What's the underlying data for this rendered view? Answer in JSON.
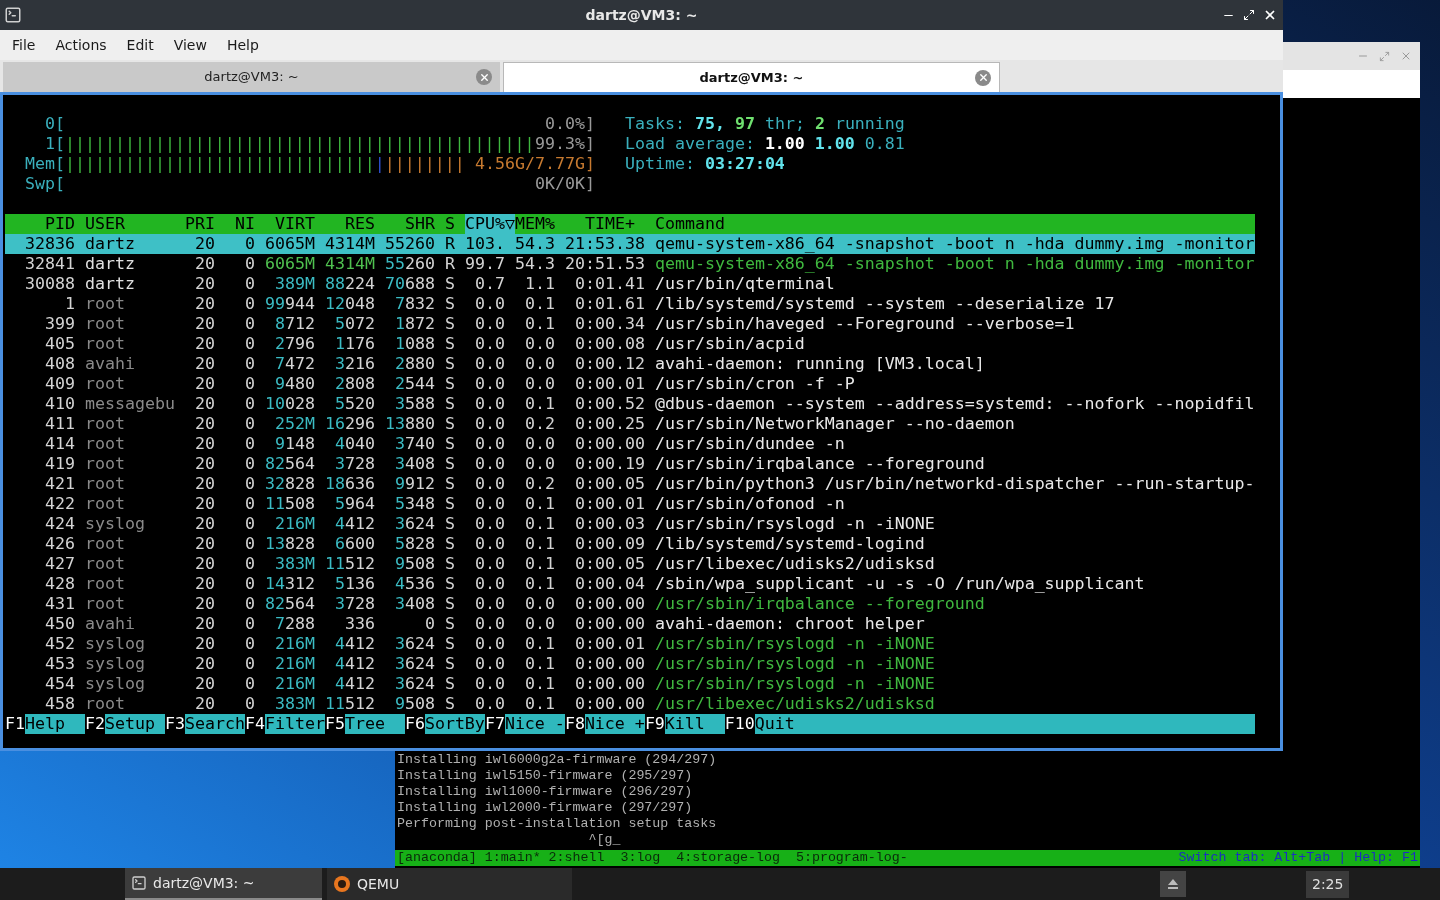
{
  "terminal_window": {
    "title": "dartz@VM3: ~",
    "menu": [
      "File",
      "Actions",
      "Edit",
      "View",
      "Help"
    ],
    "tabs": [
      {
        "label": "dartz@VM3: ~",
        "selected": false
      },
      {
        "label": "dartz@VM3: ~",
        "selected": true
      }
    ],
    "htop": {
      "cpu_meters": [
        {
          "label": "0[",
          "reading": "0.0%]"
        },
        {
          "label": "1[",
          "bar_parts": [
            {
              "text": "|||||||||||||||||||||||||||||||||||||||||||||||",
              "color": "#3fb83f"
            }
          ],
          "reading": "99.3%]"
        }
      ],
      "memory_meter": {
        "label": "Mem[",
        "reading": "4.56G/7.77G]",
        "bar_parts": [
          {
            "text": "|||||||||||||||||||||||||||||||",
            "color": "#3fb83f"
          },
          {
            "text": "|",
            "color": "#2f50d0"
          },
          {
            "text": "||||||||",
            "color": "#c77a30"
          }
        ]
      },
      "swap_meter": {
        "label": "Swp[",
        "reading": "0K/0K]"
      },
      "summary": [
        [
          {
            "text": "Tasks:",
            "kind": "label"
          },
          {
            "text": "75,",
            "kind": "cyan"
          },
          {
            "text": "97",
            "kind": "green"
          },
          {
            "text": "thr;",
            "kind": "label"
          },
          {
            "text": "2",
            "kind": "green"
          },
          {
            "text": "running",
            "kind": "label"
          }
        ],
        [
          {
            "text": "Load average:",
            "kind": "label"
          },
          {
            "text": "1.00",
            "kind": "white"
          },
          {
            "text": "1.00",
            "kind": "cyan"
          },
          {
            "text": "0.81",
            "kind": "label"
          }
        ],
        [
          {
            "text": "Uptime:",
            "kind": "label"
          },
          {
            "text": "03:27:04",
            "kind": "cyan"
          }
        ]
      ],
      "columns": [
        {
          "label": "PID",
          "sorted": false
        },
        {
          "label": "USER",
          "sorted": false
        },
        {
          "label": "PRI",
          "sorted": false
        },
        {
          "label": "NI",
          "sorted": false
        },
        {
          "label": "VIRT",
          "sorted": false
        },
        {
          "label": "RES",
          "sorted": false
        },
        {
          "label": "SHR",
          "sorted": false
        },
        {
          "label": "S",
          "sorted": false
        },
        {
          "label": "CPU%▽",
          "sorted": true
        },
        {
          "label": "MEM%",
          "sorted": false
        },
        {
          "label": "TIME+",
          "sorted": false
        },
        {
          "label": "Command",
          "sorted": false
        }
      ],
      "rows": [
        {
          "pid": "32836",
          "user": "dartz",
          "pri": "20",
          "ni": "0",
          "virt": "6065M",
          "res": "4314M",
          "shr": "55260",
          "state": "R",
          "cpu": "103.",
          "mem": "54.3",
          "time": "21:53.38",
          "command": "qemu-system-x86_64 -snapshot -boot n -hda dummy.img -monitor",
          "selected": true,
          "thread": false
        },
        {
          "pid": "32841",
          "user": "dartz",
          "pri": "20",
          "ni": "0",
          "virt": "6065M",
          "res": "4314M",
          "shr": "55260",
          "state": "R",
          "cpu": "99.7",
          "mem": "54.3",
          "time": "20:51.53",
          "command": "qemu-system-x86_64 -snapshot -boot n -hda dummy.img -monitor",
          "selected": false,
          "thread": true
        },
        {
          "pid": "30088",
          "user": "dartz",
          "pri": "20",
          "ni": "0",
          "virt": "389M",
          "res": "88224",
          "shr": "70688",
          "state": "S",
          "cpu": "0.7",
          "mem": "1.1",
          "time": "0:01.41",
          "command": "/usr/bin/qterminal",
          "selected": false,
          "thread": false
        },
        {
          "pid": "1",
          "user": "root",
          "pri": "20",
          "ni": "0",
          "virt": "99944",
          "res": "12048",
          "shr": "7832",
          "state": "S",
          "cpu": "0.0",
          "mem": "0.1",
          "time": "0:01.61",
          "command": "/lib/systemd/systemd --system --deserialize 17",
          "selected": false,
          "thread": false
        },
        {
          "pid": "399",
          "user": "root",
          "pri": "20",
          "ni": "0",
          "virt": "8712",
          "res": "5072",
          "shr": "1872",
          "state": "S",
          "cpu": "0.0",
          "mem": "0.1",
          "time": "0:00.34",
          "command": "/usr/sbin/haveged --Foreground --verbose=1",
          "selected": false,
          "thread": false
        },
        {
          "pid": "405",
          "user": "root",
          "pri": "20",
          "ni": "0",
          "virt": "2796",
          "res": "1176",
          "shr": "1088",
          "state": "S",
          "cpu": "0.0",
          "mem": "0.0",
          "time": "0:00.08",
          "command": "/usr/sbin/acpid",
          "selected": false,
          "thread": false
        },
        {
          "pid": "408",
          "user": "avahi",
          "pri": "20",
          "ni": "0",
          "virt": "7472",
          "res": "3216",
          "shr": "2880",
          "state": "S",
          "cpu": "0.0",
          "mem": "0.0",
          "time": "0:00.12",
          "command": "avahi-daemon: running [VM3.local]",
          "selected": false,
          "thread": false
        },
        {
          "pid": "409",
          "user": "root",
          "pri": "20",
          "ni": "0",
          "virt": "9480",
          "res": "2808",
          "shr": "2544",
          "state": "S",
          "cpu": "0.0",
          "mem": "0.0",
          "time": "0:00.01",
          "command": "/usr/sbin/cron -f -P",
          "selected": false,
          "thread": false
        },
        {
          "pid": "410",
          "user": "messagebu",
          "pri": "20",
          "ni": "0",
          "virt": "10028",
          "res": "5520",
          "shr": "3588",
          "state": "S",
          "cpu": "0.0",
          "mem": "0.1",
          "time": "0:00.52",
          "command": "@dbus-daemon --system --address=systemd: --nofork --nopidfil",
          "selected": false,
          "thread": false
        },
        {
          "pid": "411",
          "user": "root",
          "pri": "20",
          "ni": "0",
          "virt": "252M",
          "res": "16296",
          "shr": "13880",
          "state": "S",
          "cpu": "0.0",
          "mem": "0.2",
          "time": "0:00.25",
          "command": "/usr/sbin/NetworkManager --no-daemon",
          "selected": false,
          "thread": false
        },
        {
          "pid": "414",
          "user": "root",
          "pri": "20",
          "ni": "0",
          "virt": "9148",
          "res": "4040",
          "shr": "3740",
          "state": "S",
          "cpu": "0.0",
          "mem": "0.0",
          "time": "0:00.00",
          "command": "/usr/sbin/dundee -n",
          "selected": false,
          "thread": false
        },
        {
          "pid": "419",
          "user": "root",
          "pri": "20",
          "ni": "0",
          "virt": "82564",
          "res": "3728",
          "shr": "3408",
          "state": "S",
          "cpu": "0.0",
          "mem": "0.0",
          "time": "0:00.19",
          "command": "/usr/sbin/irqbalance --foreground",
          "selected": false,
          "thread": false
        },
        {
          "pid": "421",
          "user": "root",
          "pri": "20",
          "ni": "0",
          "virt": "32828",
          "res": "18636",
          "shr": "9912",
          "state": "S",
          "cpu": "0.0",
          "mem": "0.2",
          "time": "0:00.05",
          "command": "/usr/bin/python3 /usr/bin/networkd-dispatcher --run-startup-",
          "selected": false,
          "thread": false
        },
        {
          "pid": "422",
          "user": "root",
          "pri": "20",
          "ni": "0",
          "virt": "11508",
          "res": "5964",
          "shr": "5348",
          "state": "S",
          "cpu": "0.0",
          "mem": "0.1",
          "time": "0:00.01",
          "command": "/usr/sbin/ofonod -n",
          "selected": false,
          "thread": false
        },
        {
          "pid": "424",
          "user": "syslog",
          "pri": "20",
          "ni": "0",
          "virt": "216M",
          "res": "4412",
          "shr": "3624",
          "state": "S",
          "cpu": "0.0",
          "mem": "0.1",
          "time": "0:00.03",
          "command": "/usr/sbin/rsyslogd -n -iNONE",
          "selected": false,
          "thread": false
        },
        {
          "pid": "426",
          "user": "root",
          "pri": "20",
          "ni": "0",
          "virt": "13828",
          "res": "6600",
          "shr": "5828",
          "state": "S",
          "cpu": "0.0",
          "mem": "0.1",
          "time": "0:00.09",
          "command": "/lib/systemd/systemd-logind",
          "selected": false,
          "thread": false
        },
        {
          "pid": "427",
          "user": "root",
          "pri": "20",
          "ni": "0",
          "virt": "383M",
          "res": "11512",
          "shr": "9508",
          "state": "S",
          "cpu": "0.0",
          "mem": "0.1",
          "time": "0:00.05",
          "command": "/usr/libexec/udisks2/udisksd",
          "selected": false,
          "thread": false
        },
        {
          "pid": "428",
          "user": "root",
          "pri": "20",
          "ni": "0",
          "virt": "14312",
          "res": "5136",
          "shr": "4536",
          "state": "S",
          "cpu": "0.0",
          "mem": "0.1",
          "time": "0:00.04",
          "command": "/sbin/wpa_supplicant -u -s -O /run/wpa_supplicant",
          "selected": false,
          "thread": false
        },
        {
          "pid": "431",
          "user": "root",
          "pri": "20",
          "ni": "0",
          "virt": "82564",
          "res": "3728",
          "shr": "3408",
          "state": "S",
          "cpu": "0.0",
          "mem": "0.0",
          "time": "0:00.00",
          "command": "/usr/sbin/irqbalance --foreground",
          "selected": false,
          "thread": true
        },
        {
          "pid": "450",
          "user": "avahi",
          "pri": "20",
          "ni": "0",
          "virt": "7288",
          "res": "336",
          "shr": "0",
          "state": "S",
          "cpu": "0.0",
          "mem": "0.0",
          "time": "0:00.00",
          "command": "avahi-daemon: chroot helper",
          "selected": false,
          "thread": false
        },
        {
          "pid": "452",
          "user": "syslog",
          "pri": "20",
          "ni": "0",
          "virt": "216M",
          "res": "4412",
          "shr": "3624",
          "state": "S",
          "cpu": "0.0",
          "mem": "0.1",
          "time": "0:00.01",
          "command": "/usr/sbin/rsyslogd -n -iNONE",
          "selected": false,
          "thread": true
        },
        {
          "pid": "453",
          "user": "syslog",
          "pri": "20",
          "ni": "0",
          "virt": "216M",
          "res": "4412",
          "shr": "3624",
          "state": "S",
          "cpu": "0.0",
          "mem": "0.1",
          "time": "0:00.00",
          "command": "/usr/sbin/rsyslogd -n -iNONE",
          "selected": false,
          "thread": true
        },
        {
          "pid": "454",
          "user": "syslog",
          "pri": "20",
          "ni": "0",
          "virt": "216M",
          "res": "4412",
          "shr": "3624",
          "state": "S",
          "cpu": "0.0",
          "mem": "0.1",
          "time": "0:00.00",
          "command": "/usr/sbin/rsyslogd -n -iNONE",
          "selected": false,
          "thread": true
        },
        {
          "pid": "458",
          "user": "root",
          "pri": "20",
          "ni": "0",
          "virt": "383M",
          "res": "11512",
          "shr": "9508",
          "state": "S",
          "cpu": "0.0",
          "mem": "0.1",
          "time": "0:00.00",
          "command": "/usr/libexec/udisks2/udisksd",
          "selected": false,
          "thread": true
        }
      ],
      "function_keys": [
        {
          "key": "F1",
          "label": "Help"
        },
        {
          "key": "F2",
          "label": "Setup"
        },
        {
          "key": "F3",
          "label": "Search"
        },
        {
          "key": "F4",
          "label": "Filter"
        },
        {
          "key": "F5",
          "label": "Tree"
        },
        {
          "key": "F6",
          "label": "SortBy"
        },
        {
          "key": "F7",
          "label": "Nice -"
        },
        {
          "key": "F8",
          "label": "Nice +"
        },
        {
          "key": "F9",
          "label": "Kill"
        },
        {
          "key": "F10",
          "label": "Quit"
        }
      ]
    }
  },
  "qemu_window": {
    "console_lines": [
      "Installing iwl6000g2a-firmware (294/297)",
      "Installing iwl5150-firmware (295/297)",
      "Installing iwl1000-firmware (296/297)",
      "Installing iwl2000-firmware (297/297)",
      "Performing post-installation setup tasks",
      "                        ^[g_"
    ],
    "status_left": "[anaconda] 1:main* 2:shell  3:log  4:storage-log  5:program-log-",
    "status_right": "Switch tab: Alt+Tab | Help: F1"
  },
  "taskbar": {
    "tasks": [
      {
        "label": "dartz@VM3: ~",
        "kind": "terminal",
        "selected": true
      },
      {
        "label": "QEMU",
        "kind": "qemu",
        "selected": false
      }
    ],
    "clock": "2:25"
  }
}
